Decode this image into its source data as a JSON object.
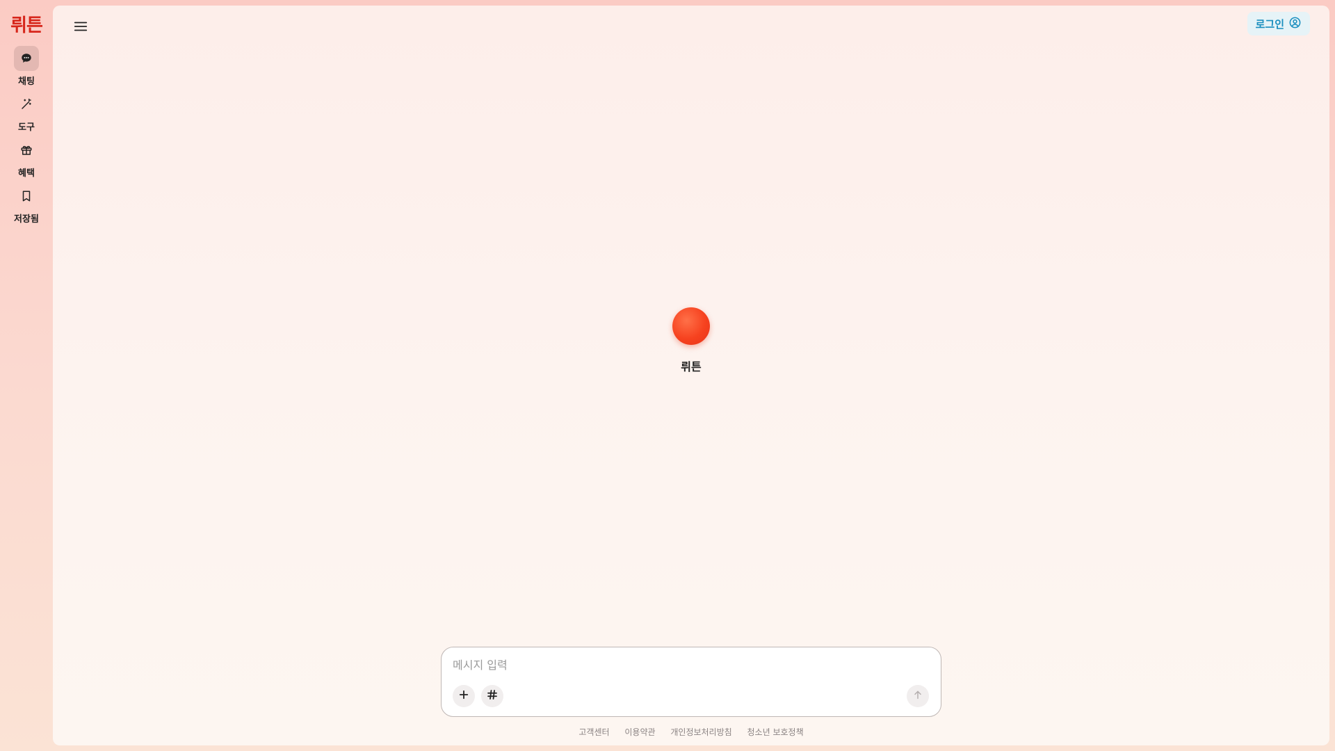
{
  "brand": {
    "logo_text": "뤼튼",
    "color": "#d7261b"
  },
  "rail": {
    "items": [
      {
        "label": "채팅",
        "icon": "chat-bubble-icon",
        "active": true
      },
      {
        "label": "도구",
        "icon": "magic-wand-icon",
        "active": false
      },
      {
        "label": "혜택",
        "icon": "gift-icon",
        "active": false
      },
      {
        "label": "저장됨",
        "icon": "bookmark-icon",
        "active": false
      }
    ]
  },
  "header": {
    "menu_icon": "hamburger-menu-icon",
    "login_label": "로그인",
    "login_icon": "user-circle-icon",
    "login_color": "#1b8fbf"
  },
  "center": {
    "assistant_name": "뤼튼",
    "orb_color": "#f6421f"
  },
  "composer": {
    "placeholder": "메시지 입력",
    "value": "",
    "add_icon": "plus-icon",
    "hashtag_icon": "hashtag-icon",
    "send_icon": "arrow-up-icon"
  },
  "footer": {
    "links": [
      "고객센터",
      "이용약관",
      "개인정보처리방침",
      "청소년 보호정책"
    ]
  }
}
